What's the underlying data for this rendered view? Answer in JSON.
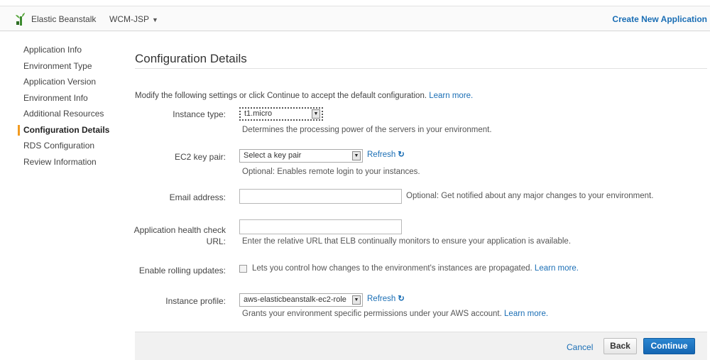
{
  "header": {
    "service": "Elastic Beanstalk",
    "app_name": "WCM-JSP",
    "app_caret": "▼",
    "create_link": "Create New Application"
  },
  "sidebar": {
    "items": [
      {
        "label": "Application Info"
      },
      {
        "label": "Environment Type"
      },
      {
        "label": "Application Version"
      },
      {
        "label": "Environment Info"
      },
      {
        "label": "Additional Resources"
      },
      {
        "label": "Configuration Details",
        "active": true
      },
      {
        "label": "RDS Configuration"
      },
      {
        "label": "Review Information"
      }
    ]
  },
  "main": {
    "title": "Configuration Details",
    "intro": "Modify the following settings or click Continue to accept the default configuration.",
    "intro_link": "Learn more.",
    "instance_type": {
      "label": "Instance type:",
      "value": "t1.micro",
      "help": "Determines the processing power of the servers in your environment."
    },
    "key_pair": {
      "label": "EC2 key pair:",
      "value": "Select a key pair",
      "refresh": "Refresh",
      "help": "Optional: Enables remote login to your instances."
    },
    "email": {
      "label": "Email address:",
      "value": "",
      "help": "Optional: Get notified about any major changes to your environment."
    },
    "health_check": {
      "label_line1": "Application health check",
      "label_line2": "URL:",
      "value": "",
      "help": "Enter the relative URL that ELB continually monitors to ensure your application is available."
    },
    "rolling_updates": {
      "label": "Enable rolling updates:",
      "checked": false,
      "help": "Lets you control how changes to the environment's instances are propagated.",
      "link": "Learn more."
    },
    "instance_profile": {
      "label": "Instance profile:",
      "value": "aws-elasticbeanstalk-ec2-role",
      "refresh": "Refresh",
      "help": "Grants your environment specific permissions under your AWS account.",
      "link": "Learn more."
    }
  },
  "footer": {
    "cancel": "Cancel",
    "back": "Back",
    "continue": "Continue"
  },
  "colors": {
    "link": "#1a6eb5",
    "active_marker": "#f29b21",
    "primary_button": "#1a6eb5",
    "logo": "#3c8a2e"
  },
  "icons": {
    "logo": "elastic-beanstalk-logo",
    "refresh": "refresh-icon",
    "dropdown": "chevron-down-icon"
  }
}
